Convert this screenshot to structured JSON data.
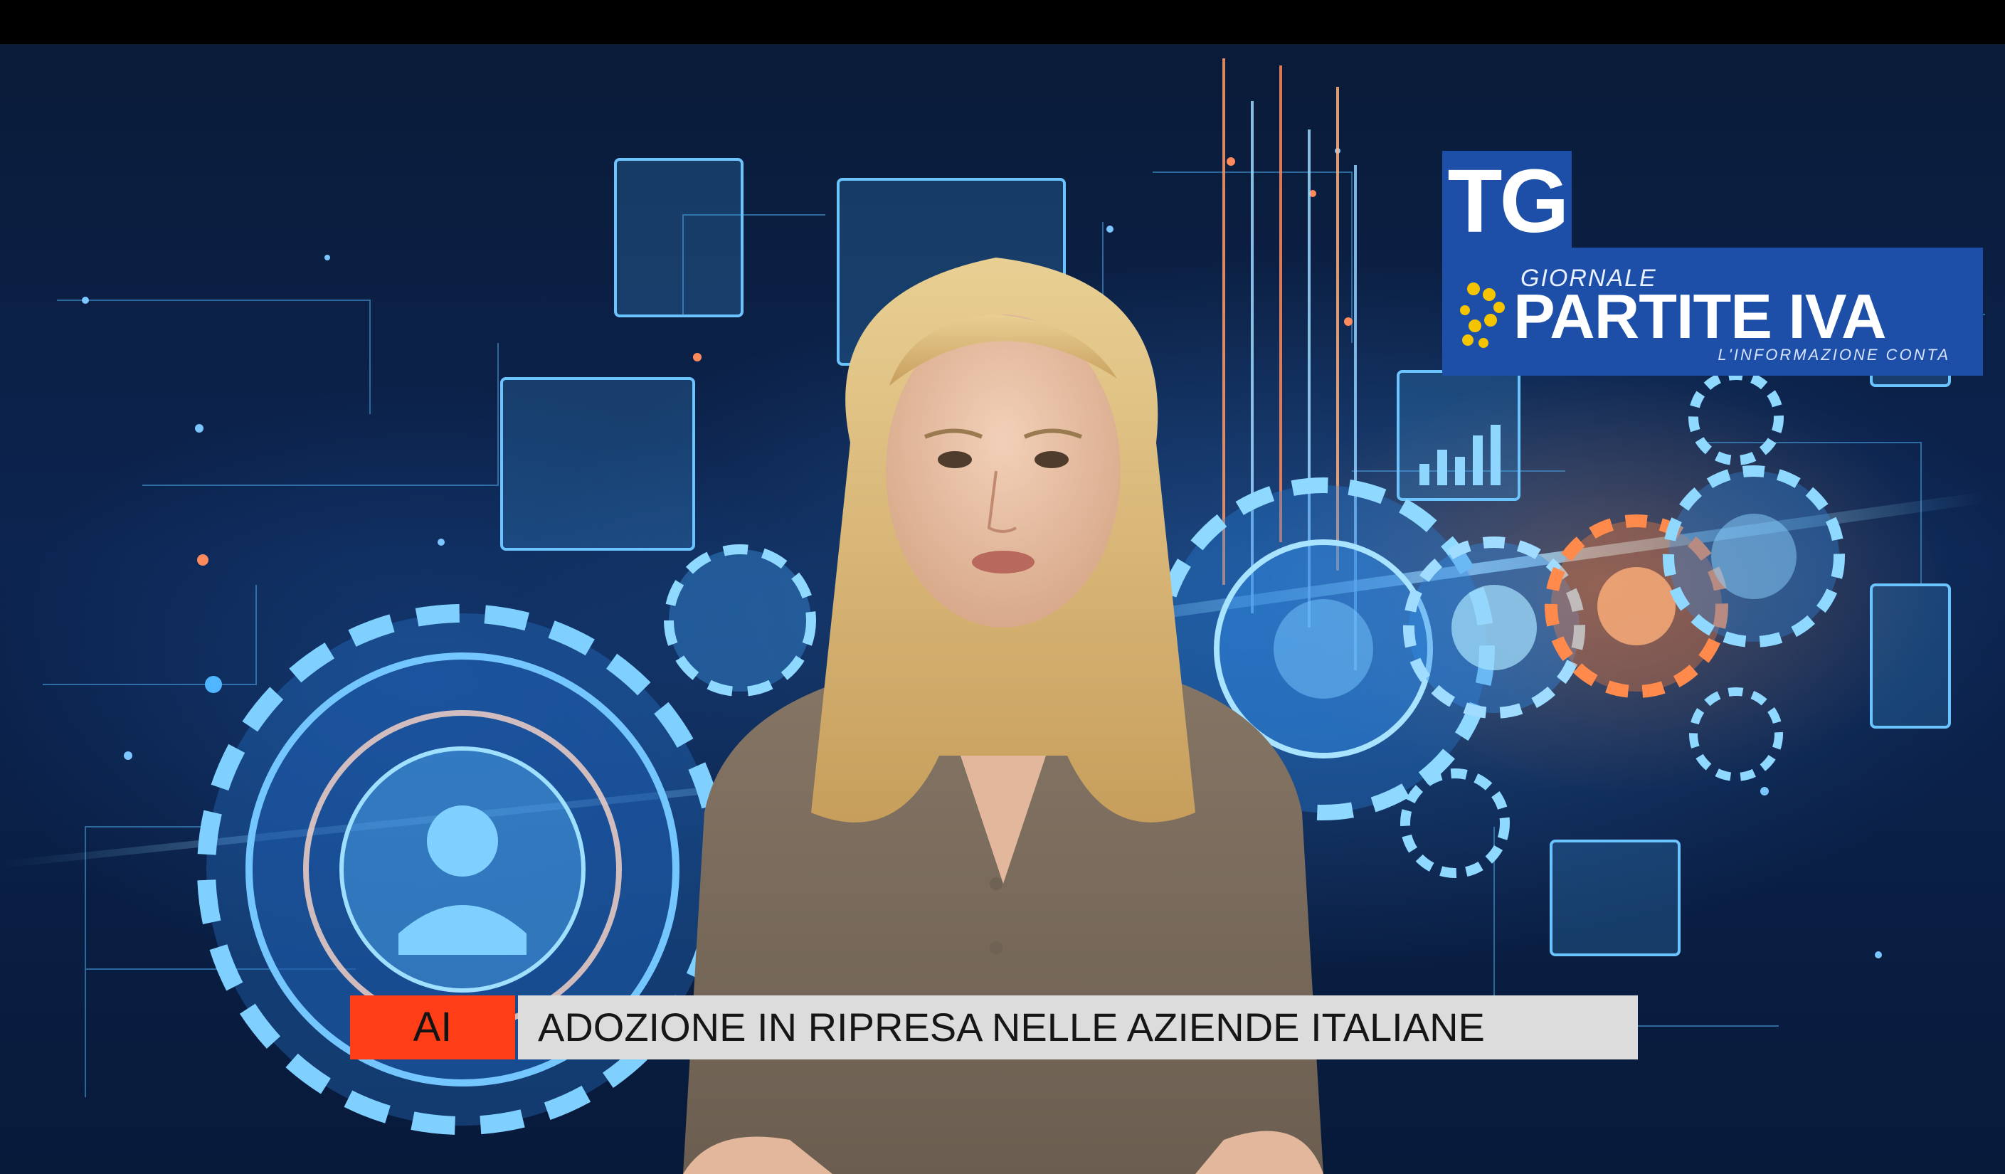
{
  "logo": {
    "tg": "TG",
    "giornale": "GIORNALE",
    "name": "PARTITE IVA",
    "tagline": "L'INFORMAZIONE CONTA",
    "brand_color": "#1d4fa8",
    "mark_color": "#f5c400"
  },
  "lower_third": {
    "tag": "AI",
    "headline": "ADOZIONE IN RIPRESA NELLE AZIENDE ITALIANE",
    "tag_color": "#ff3d17",
    "headline_bg": "#dcdcdc"
  }
}
